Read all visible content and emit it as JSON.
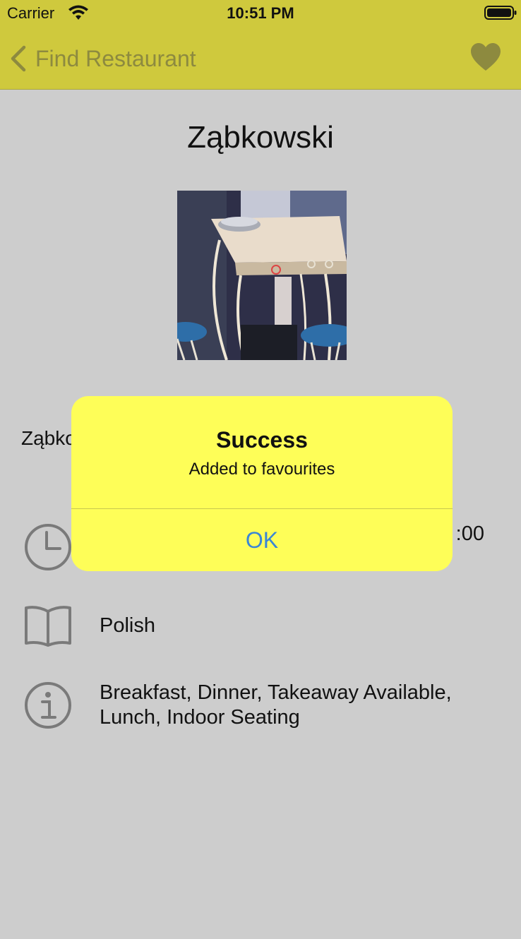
{
  "status_bar": {
    "carrier": "Carrier",
    "time": "10:51 PM"
  },
  "nav": {
    "back_label": "Find Restaurant",
    "favourite_icon": "heart-icon"
  },
  "restaurant": {
    "name": "Ząbkowski",
    "photo": "restaurant-photo",
    "address_partial": "Ząbko",
    "hours_partial": ":00",
    "cuisine": "Polish",
    "features_line1": "Breakfast, Dinner, Takeaway Available,",
    "features_line2": "Lunch, Indoor Seating"
  },
  "alert": {
    "title": "Success",
    "message": "Added to favourites",
    "ok_label": "OK"
  },
  "colors": {
    "nav_bar": "#cfc93d",
    "nav_tint": "#8d8a3f",
    "background": "#cdcdcd",
    "alert_bg": "#fefe58",
    "alert_button": "#3a86d6"
  }
}
